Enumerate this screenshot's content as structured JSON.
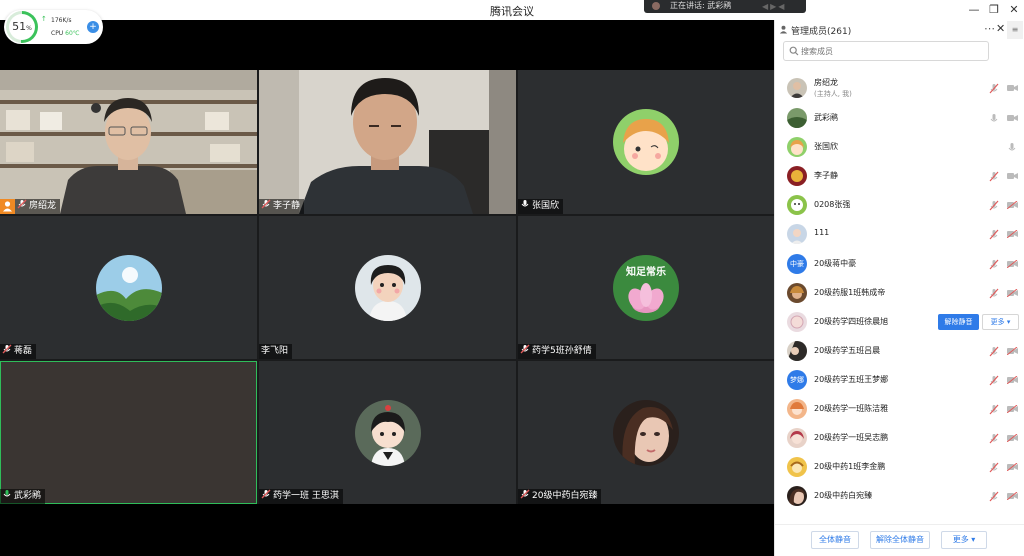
{
  "window": {
    "title": "腾讯会议",
    "speaking_text": "正在讲话: 武彩鹇"
  },
  "cpu_widget": {
    "percent_value": "51",
    "percent_sign": "%",
    "net_speed": "176K/s",
    "cpu_label": "CPU",
    "cpu_temp": "60℃"
  },
  "tiles": [
    {
      "name": "房绍龙",
      "kind": "video"
    },
    {
      "name": "李子静",
      "kind": "video"
    },
    {
      "name": "张国欣",
      "kind": "avatar"
    },
    {
      "name": "蒋磊",
      "kind": "avatar"
    },
    {
      "name": "李飞阳",
      "kind": "avatar"
    },
    {
      "name": "药学5班孙舒倩",
      "kind": "avatar"
    },
    {
      "name": "武彩鹇",
      "kind": "empty"
    },
    {
      "name": "药学一班  王思淇",
      "kind": "avatar"
    },
    {
      "name": "20级中药白宛臻",
      "kind": "avatar"
    }
  ],
  "lotus_caption": "知足常乐",
  "panel": {
    "title": "管理成员(261)",
    "search_placeholder": "搜索成员",
    "members": [
      {
        "name": "房绍龙",
        "sub": "(主持人, 我)"
      },
      {
        "name": "武彩鹇"
      },
      {
        "name": "张国欣"
      },
      {
        "name": "李子静"
      },
      {
        "name": "0208张强"
      },
      {
        "name": "111"
      },
      {
        "name": "20级蒋中豪",
        "avatar_text": "中豪"
      },
      {
        "name": "20级药服1班韩成帝"
      },
      {
        "name": "20级药学四班徐晨旭"
      },
      {
        "name": "20级药学五班吕晨"
      },
      {
        "name": "20级药学五班王梦娜",
        "avatar_text": "梦娜"
      },
      {
        "name": "20级药学一班陈洁雅"
      },
      {
        "name": "20级药学一班吴志鹏"
      },
      {
        "name": "20级中药1班李金鹏"
      },
      {
        "name": "20级中药白宛臻"
      }
    ],
    "unmute_label": "解除静音",
    "more_label": "更多 ▾"
  },
  "footer": {
    "mute_all": "全体静音",
    "unmute_all": "解除全体静音",
    "more": "更多 ▾"
  },
  "icons": {
    "mic_muted": "mic-muted-icon",
    "mic": "mic-icon",
    "camera_off": "camera-off-icon",
    "camera": "camera-icon",
    "search": "search-icon",
    "members": "members-icon",
    "host": "host-icon"
  },
  "colors": {
    "accent": "#2f7be8",
    "muted_red": "#e05a5a",
    "speaking_green": "#2fbd5a",
    "host_orange": "#f08a24"
  }
}
